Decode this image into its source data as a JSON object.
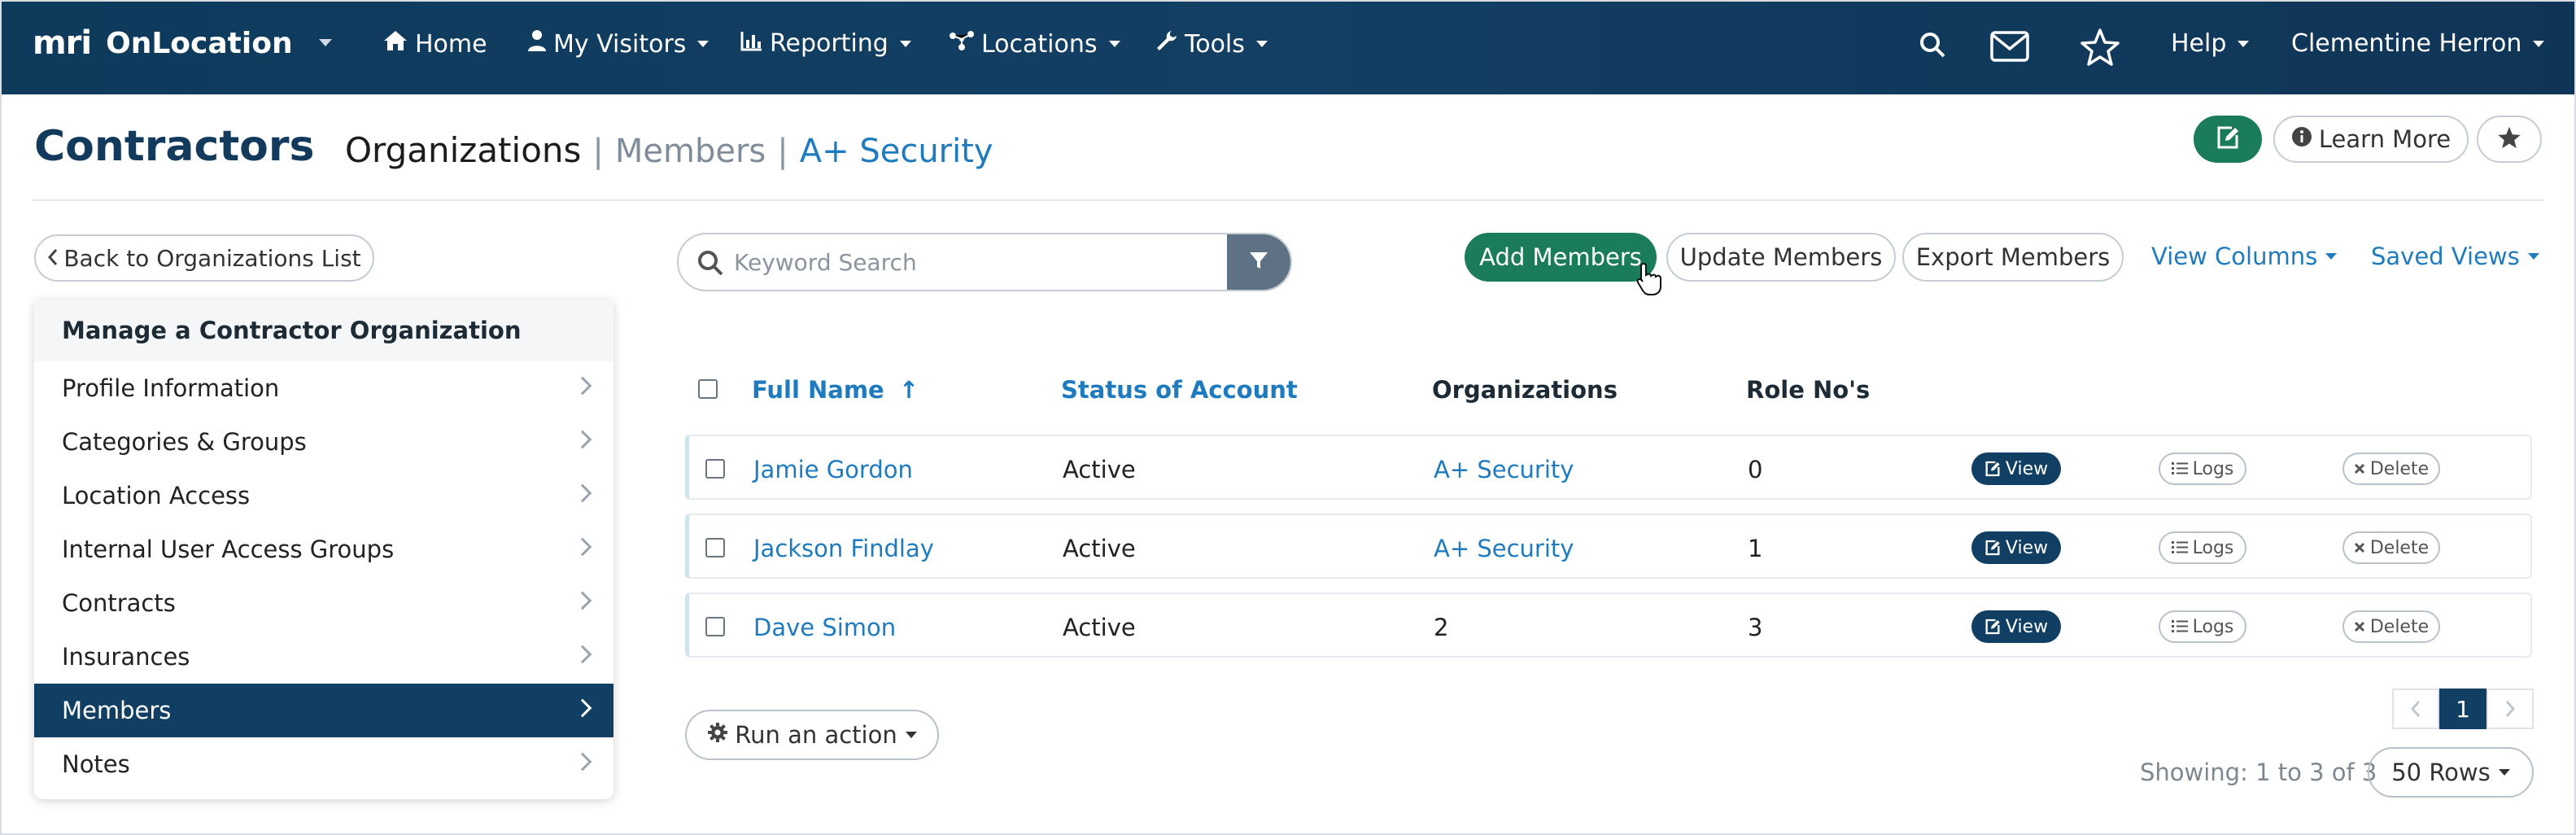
{
  "nav": {
    "brand_mark": "mri",
    "brand_name": "OnLocation",
    "items": [
      {
        "label": "Home",
        "icon": "home-icon"
      },
      {
        "label": "My Visitors",
        "icon": "user-icon"
      },
      {
        "label": "Reporting",
        "icon": "bar-chart-icon"
      },
      {
        "label": "Locations",
        "icon": "network-icon"
      },
      {
        "label": "Tools",
        "icon": "wrench-icon"
      }
    ],
    "help_label": "Help",
    "user_name": "Clementine Herron"
  },
  "header": {
    "title": "Contractors",
    "breadcrumb_org": "Organizations",
    "breadcrumb_sep": "|",
    "breadcrumb_members": "Members",
    "breadcrumb_security": "A+ Security",
    "learn_more": "Learn More"
  },
  "sidebar": {
    "back_label": "Back to Organizations List",
    "heading": "Manage a Contractor Organization",
    "items": [
      {
        "label": "Profile Information"
      },
      {
        "label": "Categories & Groups"
      },
      {
        "label": "Location Access"
      },
      {
        "label": "Internal User Access Groups"
      },
      {
        "label": "Contracts"
      },
      {
        "label": "Insurances"
      },
      {
        "label": "Members",
        "active": true
      },
      {
        "label": "Notes"
      }
    ]
  },
  "toolbar": {
    "search_placeholder": "Keyword Search",
    "add_members": "Add Members",
    "update_members": "Update Members",
    "export_members": "Export Members",
    "view_columns": "View Columns",
    "saved_views": "Saved Views"
  },
  "table": {
    "columns": [
      "Full Name",
      "Status of Account",
      "Organizations",
      "Role No's"
    ],
    "sort_indicator": "↑",
    "rows": [
      {
        "name": "Jamie Gordon",
        "status": "Active",
        "organizations": "A+ Security",
        "roles": "0"
      },
      {
        "name": "Jackson Findlay",
        "status": "Active",
        "organizations": "A+ Security",
        "roles": "1"
      },
      {
        "name": "Dave Simon",
        "status": "Active",
        "organizations": "2",
        "roles": "3"
      }
    ],
    "view_label": "View",
    "logs_label": "Logs",
    "delete_label": "Delete"
  },
  "footer": {
    "run_action": "Run an action",
    "showing": "Showing: 1 to 3 of 3",
    "rows_per_page": "50 Rows",
    "current_page": "1"
  },
  "colors": {
    "nav_bg": "#0e3a5c",
    "primary_green": "#1b7c59",
    "link_blue": "#1f7bbf",
    "dark_navy": "#113f63"
  }
}
